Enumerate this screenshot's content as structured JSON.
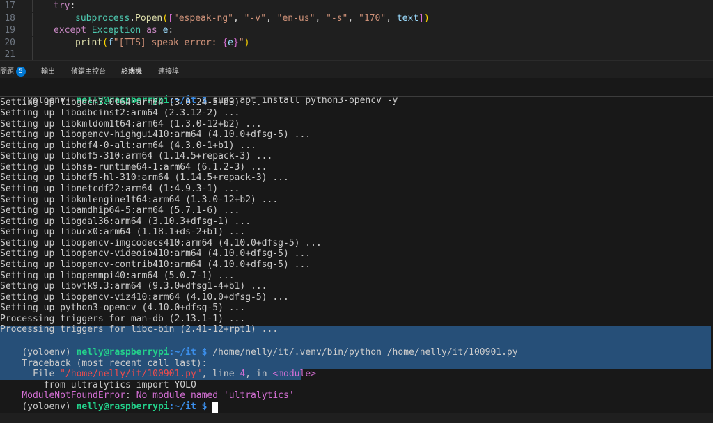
{
  "editor": {
    "lines": [
      {
        "num": "17",
        "parts": [
          [
            "kw",
            "try"
          ],
          [
            "pl",
            ":"
          ]
        ],
        "indent": 0
      },
      {
        "num": "18",
        "parts": [
          [
            "cls",
            "subprocess"
          ],
          [
            "pl",
            "."
          ],
          [
            "fn",
            "Popen"
          ],
          [
            "brk",
            "("
          ],
          [
            "brk2",
            "["
          ],
          [
            "str",
            "\"espeak-ng\""
          ],
          [
            "pl",
            ", "
          ],
          [
            "str",
            "\"-v\""
          ],
          [
            "pl",
            ", "
          ],
          [
            "str",
            "\"en-us\""
          ],
          [
            "pl",
            ", "
          ],
          [
            "str",
            "\"-s\""
          ],
          [
            "pl",
            ", "
          ],
          [
            "str",
            "\"170\""
          ],
          [
            "pl",
            ", "
          ],
          [
            "var",
            "text"
          ],
          [
            "brk2",
            "]"
          ],
          [
            "brk",
            ")"
          ]
        ],
        "indent": 1
      },
      {
        "num": "19",
        "parts": [
          [
            "kw",
            "except"
          ],
          [
            "pl",
            " "
          ],
          [
            "cls",
            "Exception"
          ],
          [
            "pl",
            " "
          ],
          [
            "kw",
            "as"
          ],
          [
            "pl",
            " "
          ],
          [
            "var",
            "e"
          ],
          [
            "pl",
            ":"
          ]
        ],
        "indent": 0
      },
      {
        "num": "20",
        "parts": [
          [
            "fn",
            "print"
          ],
          [
            "brk",
            "("
          ],
          [
            "var",
            "f"
          ],
          [
            "str",
            "\"[TTS] speak error: "
          ],
          [
            "brk2",
            "{"
          ],
          [
            "var",
            "e"
          ],
          [
            "brk2",
            "}"
          ],
          [
            "str",
            "\""
          ],
          [
            "brk",
            ")"
          ]
        ],
        "indent": 1
      },
      {
        "num": "21",
        "parts": [],
        "indent": 0
      }
    ]
  },
  "panel": {
    "tabs": [
      {
        "label": "問題",
        "badge": "5",
        "active": false
      },
      {
        "label": "輸出",
        "badge": "",
        "active": false
      },
      {
        "label": "偵錯主控台",
        "badge": "",
        "active": false
      },
      {
        "label": "終端機",
        "badge": "",
        "active": true
      },
      {
        "label": "連接埠",
        "badge": "",
        "active": false
      }
    ]
  },
  "terminal": {
    "prompt": {
      "env": "(yoloenv) ",
      "user": "nelly@raspberrypi",
      "sep": ":",
      "path": "~/it",
      "dollar": " $ "
    },
    "first_command": "sudo apt install python3-opencv -y",
    "setup_lines": [
      "Setting up libgdcm3.0t64:arm64 (3.0.24-5+b3) ...",
      "Setting up libodbcinst2:arm64 (2.3.12-2) ...",
      "Setting up libkmldom1t64:arm64 (1.3.0-12+b2) ...",
      "Setting up libopencv-highgui410:arm64 (4.10.0+dfsg-5) ...",
      "Setting up libhdf4-0-alt:arm64 (4.3.0-1+b1) ...",
      "Setting up libhdf5-310:arm64 (1.14.5+repack-3) ...",
      "Setting up libhsa-runtime64-1:arm64 (6.1.2-3) ...",
      "Setting up libhdf5-hl-310:arm64 (1.14.5+repack-3) ...",
      "Setting up libnetcdf22:arm64 (1:4.9.3-1) ...",
      "Setting up libkmlengine1t64:arm64 (1.3.0-12+b2) ...",
      "Setting up libamdhip64-5:arm64 (5.7.1-6) ...",
      "Setting up libgdal36:arm64 (3.10.3+dfsg-1) ...",
      "Setting up libucx0:arm64 (1.18.1+ds-2+b1) ...",
      "Setting up libopencv-imgcodecs410:arm64 (4.10.0+dfsg-5) ...",
      "Setting up libopencv-videoio410:arm64 (4.10.0+dfsg-5) ...",
      "Setting up libopencv-contrib410:arm64 (4.10.0+dfsg-5) ...",
      "Setting up libopenmpi40:arm64 (5.0.7-1) ...",
      "Setting up libvtk9.3:arm64 (9.3.0+dfsg1-4+b1) ...",
      "Setting up libopencv-viz410:arm64 (4.10.0+dfsg-5) ...",
      "Setting up python3-opencv (4.10.0+dfsg-5) ...",
      "Processing triggers for man-db (2.13.1-1) ...",
      "Processing triggers for libc-bin (2.41-12+rpt1) ..."
    ],
    "second_command": "/home/nelly/it/.venv/bin/python /home/nelly/it/100901.py",
    "traceback_header": "Traceback (most recent call last):",
    "traceback_file_prefix": "  File ",
    "traceback_file": "\"/home/nelly/it/100901.py\"",
    "traceback_line_label": ", line ",
    "traceback_line_num": "4",
    "traceback_in": ", in ",
    "traceback_module": "<module>",
    "traceback_code": "    from ultralytics import YOLO",
    "error_name": "ModuleNotFoundError",
    "error_sep": ": ",
    "error_msg": "No module named 'ultralytics'"
  }
}
